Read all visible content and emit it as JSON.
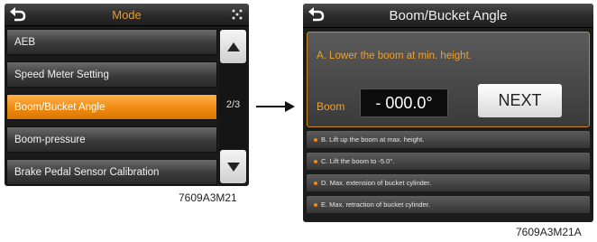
{
  "left_screen": {
    "title": "Mode",
    "menu_items": [
      {
        "label": "AEB"
      },
      {
        "label": "Speed Meter Setting"
      },
      {
        "label": "Boom/Bucket Angle",
        "selected": true
      },
      {
        "label": "Boom-pressure"
      },
      {
        "label": "Brake Pedal Sensor Calibration"
      }
    ],
    "page_indicator": "2/3",
    "caption": "7609A3M21"
  },
  "right_screen": {
    "title": "Boom/Bucket Angle",
    "instruction": "A. Lower the boom at min. height.",
    "boom_label": "Boom",
    "boom_value": "- 000.0°",
    "next_label": "NEXT",
    "steps": [
      "B. Lift up the boom at max. height.",
      "C. Lift the boom to -5.0°.",
      "D. Max. extension of bucket cylinder.",
      "E. Max. retraction of bucket cylinder."
    ],
    "caption": "7609A3M21A"
  },
  "colors": {
    "accent": "#f08a10",
    "header_text_orange": "#e89a2a",
    "panel_border": "#cc8a1e"
  }
}
